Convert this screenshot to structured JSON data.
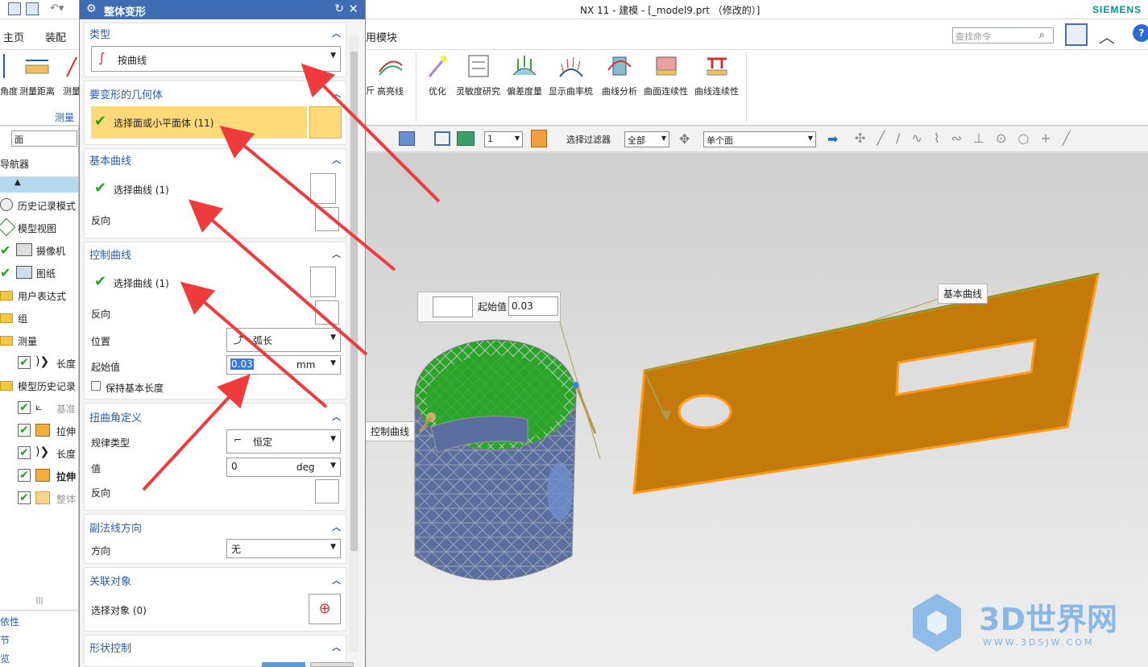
{
  "window": {
    "title": "NX 11 - 建模 - [_model9.prt （修改的）]",
    "brand": "SIEMENS"
  },
  "ribbon": {
    "tabs": [
      "主页",
      "装配",
      "用模块"
    ],
    "search_placeholder": "查找命令",
    "left_buttons": [
      "角度",
      "测量距离",
      "测量"
    ],
    "left_group_label": "测量",
    "buttons": [
      "高亮线",
      "优化",
      "灵敏度研究",
      "偏差度量",
      "显示曲率梳",
      "曲线分析",
      "曲面连续性",
      "曲线连续性"
    ],
    "partial_label": "斤"
  },
  "filter_bar": {
    "layer_value": "1",
    "filter_label": "选择过滤器",
    "filter_value": "全部",
    "scope_value": "单个面"
  },
  "navigator": {
    "search_value": "面",
    "title": "导航器",
    "items": [
      {
        "label": "历史记录模式"
      },
      {
        "label": "模型视图"
      },
      {
        "label": "摄像机"
      },
      {
        "label": "图纸"
      },
      {
        "label": "用户表达式"
      },
      {
        "label": "组"
      },
      {
        "label": "测量"
      },
      {
        "label": "长度"
      },
      {
        "label": "模型历史记录"
      },
      {
        "label": "基准"
      },
      {
        "label": "拉伸"
      },
      {
        "label": "长度"
      },
      {
        "label": "拉伸"
      },
      {
        "label": "整体"
      }
    ],
    "bottom": [
      "依性",
      "节",
      "览"
    ]
  },
  "dialog": {
    "title": "整体变形",
    "type_section": {
      "title": "类型",
      "value": "按曲线"
    },
    "geometry_section": {
      "title": "要变形的几何体",
      "select": "选择面或小平面体 (11)"
    },
    "base_curve": {
      "title": "基本曲线",
      "select": "选择曲线 (1)",
      "reverse": "反向"
    },
    "control_curve": {
      "title": "控制曲线",
      "select": "选择曲线 (1)",
      "reverse": "反向",
      "position_label": "位置",
      "position_value": "弧长",
      "start_label": "起始值",
      "start_value": "0.03",
      "start_unit": "mm",
      "keep_length": "保持基本长度"
    },
    "twist": {
      "title": "扭曲角定义",
      "law_label": "规律类型",
      "law_value": "恒定",
      "value_label": "值",
      "value": "0",
      "unit": "deg",
      "reverse": "反向"
    },
    "binormal": {
      "title": "副法线方向",
      "dir_label": "方向",
      "dir_value": "无"
    },
    "associated": {
      "title": "关联对象",
      "select": "选择对象 (0)"
    },
    "shape": {
      "title": "形状控制"
    }
  },
  "viewport": {
    "float_label": "起始值",
    "float_value": "0.03",
    "tag_base": "基本曲线",
    "tag_control": "控制曲线",
    "watermark_title": "3D世界网",
    "watermark_url": "WWW.3DSJW.COM"
  },
  "colors": {
    "accent": "#3f6db3",
    "plate": "#c47a0a",
    "edge": "#ff9a1a",
    "mesh": "#5a6fa0",
    "green": "#2aa52a",
    "arrow": "#ef3b3b"
  }
}
